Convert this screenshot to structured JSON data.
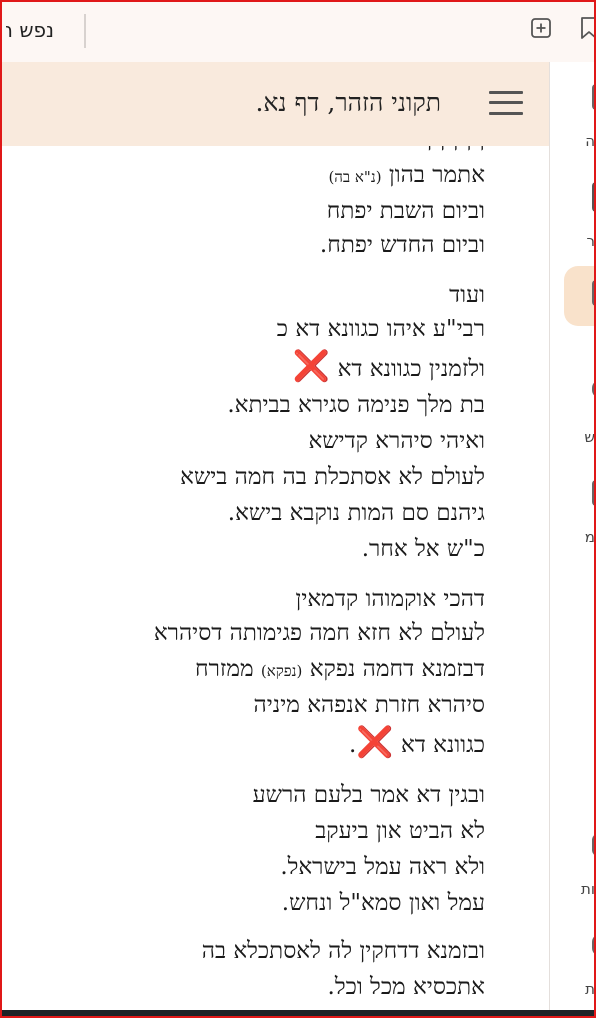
{
  "tab": {
    "title": "נפש ה"
  },
  "header": {
    "title": "תקוני הזהר, דף נא."
  },
  "sidebar": {
    "items": [
      {
        "label": ""
      },
      {
        "label": "ה"
      },
      {
        "label": "ר"
      },
      {
        "label": ""
      },
      {
        "label": "ש"
      },
      {
        "label": "מ"
      },
      {
        "label": "ות"
      },
      {
        "label": "ת"
      }
    ]
  },
  "content": {
    "lines": [
      "אתמר בהון",
      "(נ\"א בה)",
      "וביום השבת יפתח",
      "וביום החדש יפתח.",
      "ועוד",
      "רבי\"ע איהו כגוונא דא כ",
      "ולזמנין כגוונא דא",
      "❌",
      "בת מלך פנימה סגירא בביתא.",
      "ואיהי סיהרא קדישא",
      "לעולם לא אסתכלת בה חמה בישא",
      "גיהנם סם המות נוקבא בישא.",
      "כ\"ש אל אחר.",
      "דהכי אוקמוהו קדמאין",
      "לעולם לא חזא חמה פגימותה דסיהרא",
      "דבזמנא דחמה נפקא",
      "(נפקא)",
      "ממזרח",
      "סיהרא חזרת אנפהא מיניה",
      "כגוונא דא",
      "❌",
      ".",
      "ובגין דא אמר בלעם הרשע",
      "לא הביט און ביעקב",
      "ולא ראה עמל בישראל.",
      "עמל ואון סמא\"ל ונחש.",
      "ובזמנא דדחקין לה לאסתכלא בה",
      "אתכסיא מכל וכל."
    ]
  }
}
